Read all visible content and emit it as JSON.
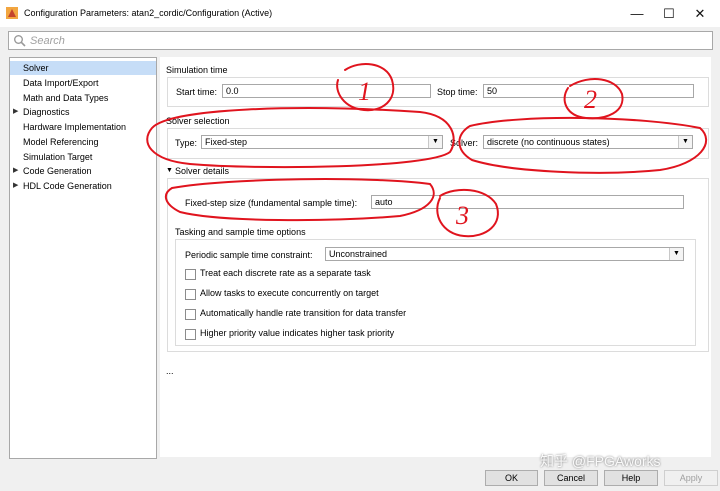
{
  "window": {
    "title": "Configuration Parameters: atan2_cordic/Configuration (Active)",
    "minimize_icon": "minimize-icon",
    "maximize_icon": "maximize-icon",
    "close_icon": "close-icon"
  },
  "search": {
    "placeholder": "Search"
  },
  "tree": {
    "items": [
      {
        "label": "Solver",
        "selected": true,
        "expandable": false
      },
      {
        "label": "Data Import/Export",
        "expandable": false
      },
      {
        "label": "Math and Data Types",
        "expandable": false
      },
      {
        "label": "Diagnostics",
        "expandable": true
      },
      {
        "label": "Hardware Implementation",
        "expandable": false
      },
      {
        "label": "Model Referencing",
        "expandable": false
      },
      {
        "label": "Simulation Target",
        "expandable": false
      },
      {
        "label": "Code Generation",
        "expandable": true
      },
      {
        "label": "HDL Code Generation",
        "expandable": true
      }
    ]
  },
  "simulation_time": {
    "title": "Simulation time",
    "start_label": "Start time:",
    "start_value": "0.0",
    "stop_label": "Stop time:",
    "stop_value": "50"
  },
  "solver_selection": {
    "title": "Solver selection",
    "type_label": "Type:",
    "type_value": "Fixed-step",
    "solver_label": "Solver:",
    "solver_value": "discrete (no continuous states)"
  },
  "solver_details": {
    "title": "Solver details",
    "step_size_label": "Fixed-step size (fundamental sample time):",
    "step_size_value": "auto",
    "tasking_title": "Tasking and sample time options",
    "periodic_label": "Periodic sample time constraint:",
    "periodic_value": "Unconstrained",
    "options": [
      {
        "label": "Treat each discrete rate as a separate task",
        "checked": false
      },
      {
        "label": "Allow tasks to execute concurrently on target",
        "checked": false
      },
      {
        "label": "Automatically handle rate transition for data transfer",
        "checked": false
      },
      {
        "label": "Higher priority value indicates higher task priority",
        "checked": false
      }
    ],
    "more": "..."
  },
  "buttons": {
    "ok": "OK",
    "cancel": "Cancel",
    "help": "Help",
    "apply": "Apply"
  },
  "annotations": {
    "labels": [
      "1",
      "2",
      "3"
    ],
    "color": "#e0141e"
  },
  "watermark": "知乎 @FPGAworks"
}
